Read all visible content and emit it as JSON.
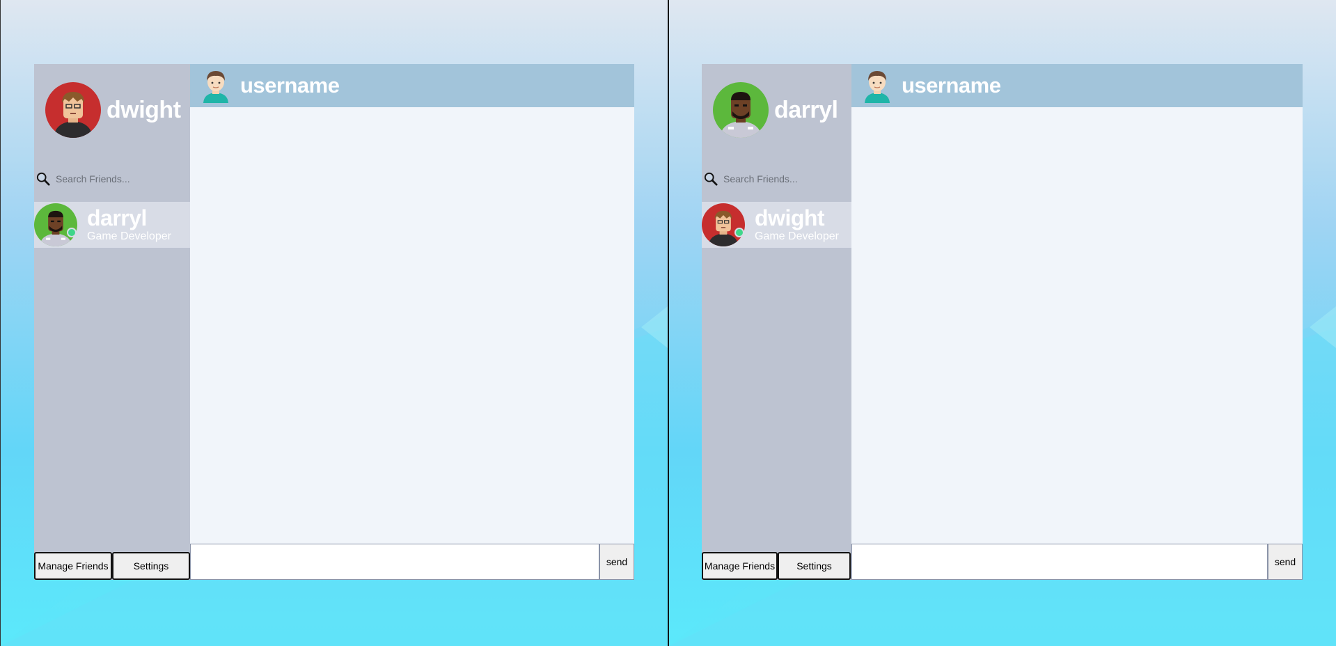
{
  "windows": [
    {
      "current_user": {
        "name": "dwight",
        "avatar": "avatar-dwight",
        "avatar_color": "#c62e2e"
      },
      "search": {
        "placeholder": "Search Friends..."
      },
      "friends": [
        {
          "name": "darryl",
          "title": "Game Developer",
          "status": "online",
          "avatar": "avatar-darryl",
          "avatar_color": "#5cb83c"
        }
      ],
      "buttons": {
        "manage_friends": "Manage Friends",
        "settings": "Settings"
      },
      "chat": {
        "header_username": "username",
        "message_placeholder": "",
        "send_label": "send"
      }
    },
    {
      "current_user": {
        "name": "darryl",
        "avatar": "avatar-darryl",
        "avatar_color": "#5cb83c"
      },
      "search": {
        "placeholder": "Search Friends..."
      },
      "friends": [
        {
          "name": "dwight",
          "title": "Game Developer",
          "status": "online",
          "avatar": "avatar-dwight",
          "avatar_color": "#c62e2e"
        }
      ],
      "buttons": {
        "manage_friends": "Manage Friends",
        "settings": "Settings"
      },
      "chat": {
        "header_username": "username",
        "message_placeholder": "",
        "send_label": "send"
      }
    }
  ],
  "colors": {
    "sidebar": "#bdc3d1",
    "friend_row": "#d8dce6",
    "chat_header": "#a2c4da",
    "messages_bg": "#f1f5fa",
    "online_dot": "#3ed68a"
  }
}
